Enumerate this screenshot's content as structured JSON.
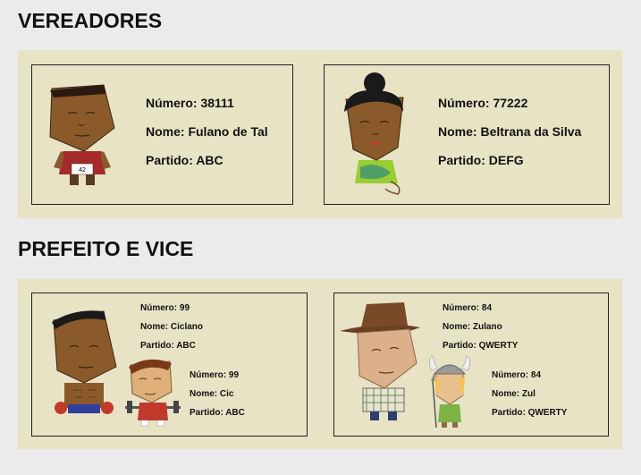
{
  "sections": {
    "vereadores_title": "VEREADORES",
    "prefeito_title": "PREFEITO E VICE"
  },
  "labels": {
    "numero": "Número:",
    "nome": "Nome:",
    "partido": "Partido:"
  },
  "vereadores": [
    {
      "numero": "38111",
      "nome": "Fulano de Tal",
      "partido": "ABC",
      "shirt_number": "42"
    },
    {
      "numero": "77222",
      "nome": "Beltrana da Silva",
      "partido": "DEFG"
    }
  ],
  "prefeitos": [
    {
      "prefeito": {
        "numero": "99",
        "nome": "Ciclano",
        "partido": "ABC"
      },
      "vice": {
        "numero": "99",
        "nome": "Cic",
        "partido": "ABC"
      }
    },
    {
      "prefeito": {
        "numero": "84",
        "nome": "Zulano",
        "partido": "QWERTY"
      },
      "vice": {
        "numero": "84",
        "nome": "Zul",
        "partido": "QWERTY"
      }
    }
  ],
  "colors": {
    "page_bg": "#ebebeb",
    "panel_bg": "#e8e3c5",
    "border": "#222222"
  }
}
